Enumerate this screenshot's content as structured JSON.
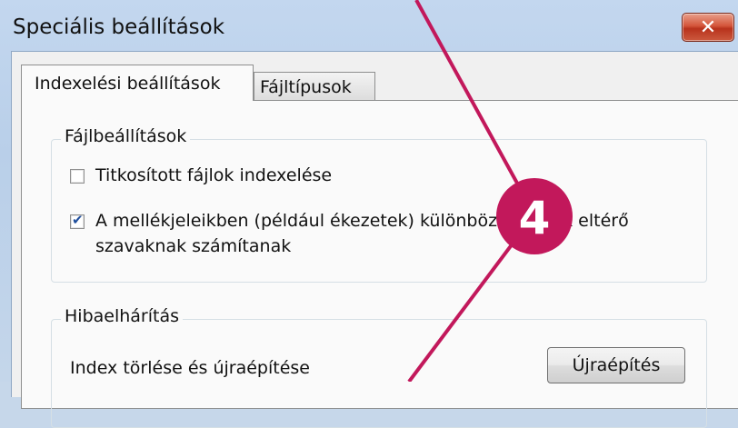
{
  "window": {
    "title": "Speciális beállítások",
    "close_label": "✕"
  },
  "tabs": [
    {
      "label": "Indexelési beállítások",
      "active": true
    },
    {
      "label": "Fájltípusok",
      "active": false
    }
  ],
  "file_settings": {
    "title": "Fájlbeállítások",
    "options": [
      {
        "label": "Titkosított fájlok indexelése",
        "checked": false
      },
      {
        "label": "A mellékjeleikben (például ékezetek) különbözö szavak eltérő szavaknak számítanak",
        "checked": true
      }
    ]
  },
  "troubleshooting": {
    "title": "Hibaelhárítás",
    "rebuild_label": "Index törlése és újraépítése",
    "rebuild_button": "Újraépítés"
  },
  "annotation": {
    "badge_label": "4",
    "color": "#c2185b"
  }
}
